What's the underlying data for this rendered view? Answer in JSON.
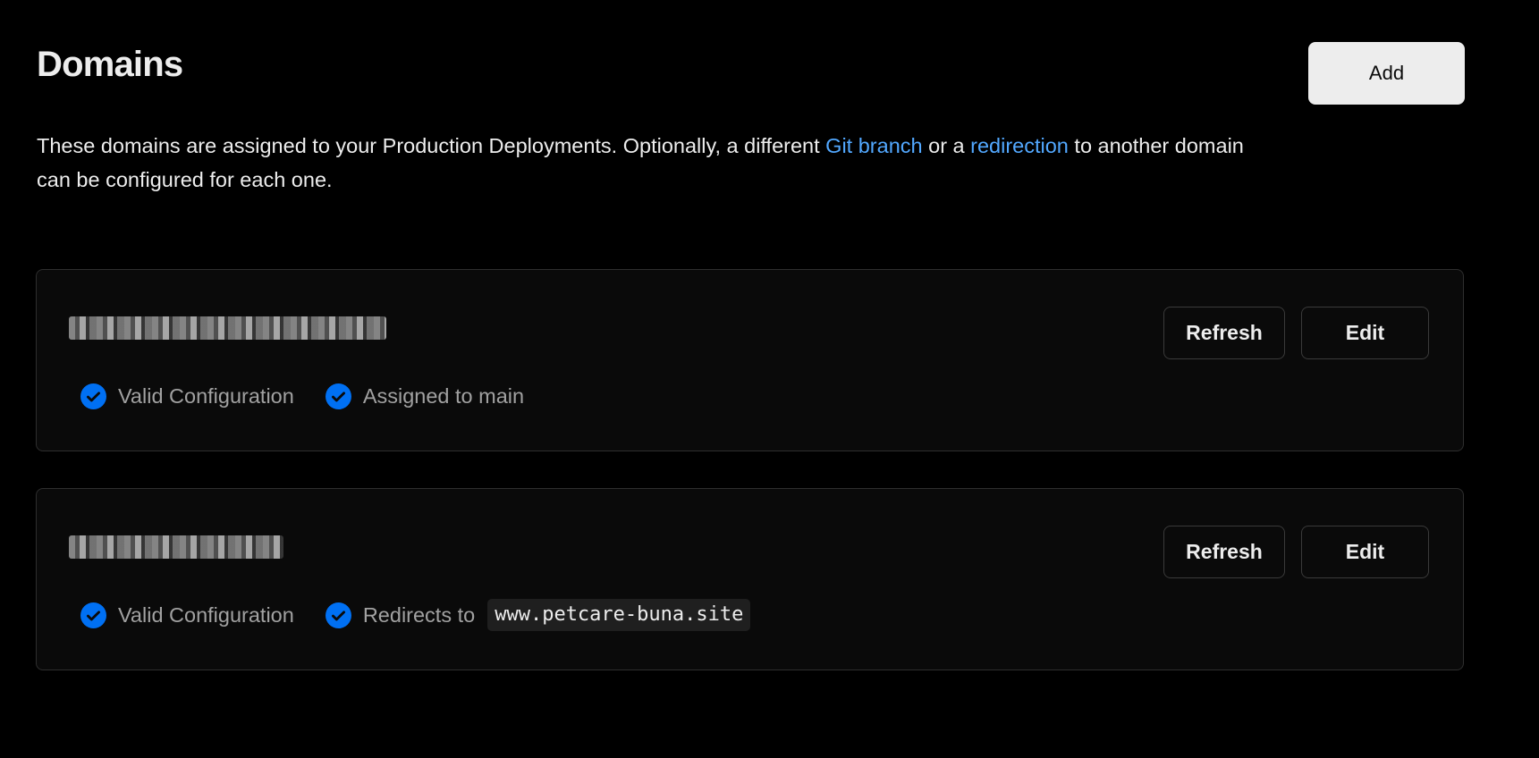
{
  "header": {
    "title": "Domains",
    "add_label": "Add"
  },
  "description": {
    "text_before": "These domains are assigned to your Production Deployments. Optionally, a different ",
    "link1": "Git branch",
    "text_middle": " or a ",
    "link2": "redirection",
    "text_after": " to another domain can be configured for each one."
  },
  "domains": [
    {
      "name_redacted": true,
      "refresh_label": "Refresh",
      "edit_label": "Edit",
      "statuses": [
        {
          "icon": "check-circle-icon",
          "text": "Valid Configuration"
        },
        {
          "icon": "check-circle-icon",
          "text": "Assigned to main"
        }
      ]
    },
    {
      "name_redacted": true,
      "refresh_label": "Refresh",
      "edit_label": "Edit",
      "statuses": [
        {
          "icon": "check-circle-icon",
          "text": "Valid Configuration"
        },
        {
          "icon": "check-circle-icon",
          "text": "Redirects to",
          "target": "www.petcare-buna.site"
        }
      ]
    }
  ],
  "colors": {
    "background": "#000000",
    "card": "#0a0a0a",
    "link": "#52a8ff",
    "check": "#0070f3",
    "muted_text": "#a1a1a1"
  }
}
